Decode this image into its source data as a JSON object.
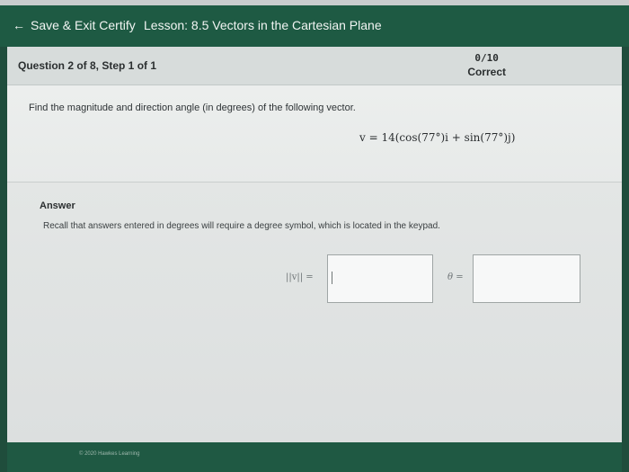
{
  "topbar": {
    "back_label": "Save & Exit Certify",
    "lesson_title": "Lesson: 8.5 Vectors in the Cartesian Plane"
  },
  "question": {
    "title": "Question 2 of 8, Step 1 of 1",
    "score": "0/10",
    "status": "Correct",
    "prompt": "Find the magnitude and direction angle (in degrees) of the following vector.",
    "equation": "v = 14(cos(77°)i + sin(77°)j)"
  },
  "answer": {
    "label": "Answer",
    "hint": "Recall that answers entered in degrees will require a degree symbol, which is located in the keypad.",
    "magnitude_label": "||v|| =",
    "angle_label": "θ ="
  },
  "footer": {
    "copyright": "© 2020 Hawkes Learning"
  },
  "colors": {
    "topbar": "#1e5a43",
    "panel": "#eef0ef"
  }
}
